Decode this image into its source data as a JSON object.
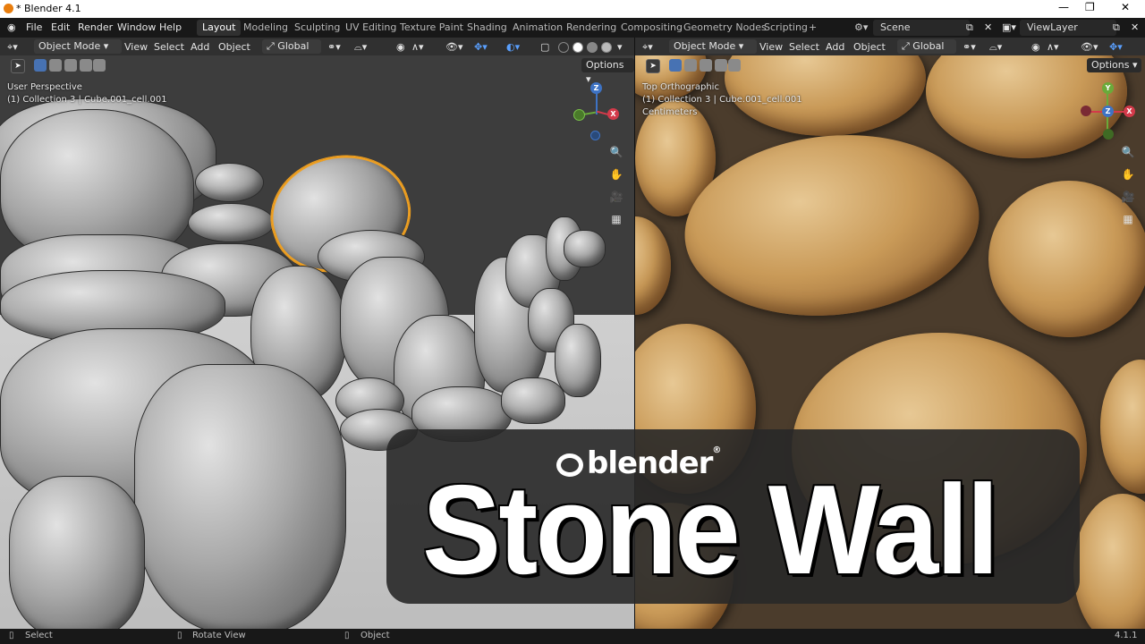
{
  "app": {
    "title": "* Blender 4.1",
    "version": "4.1.1"
  },
  "menu": {
    "items": [
      "File",
      "Edit",
      "Render",
      "Window",
      "Help"
    ],
    "workspaces": [
      "Layout",
      "Modeling",
      "Sculpting",
      "UV Editing",
      "Texture Paint",
      "Shading",
      "Animation",
      "Rendering",
      "Compositing",
      "Geometry Nodes",
      "Scripting"
    ],
    "active_workspace": "Layout",
    "add_tab": "+",
    "scene": "Scene",
    "view_layer": "ViewLayer"
  },
  "left_viewport": {
    "mode": "Object Mode",
    "menus": [
      "View",
      "Select",
      "Add",
      "Object"
    ],
    "orientation": "Global",
    "options": "Options",
    "overlay_line1": "User Perspective",
    "overlay_line2": "(1) Collection 3 | Cube.001_cell.001"
  },
  "right_viewport": {
    "mode": "Object Mode",
    "menus": [
      "View",
      "Select",
      "Add",
      "Object"
    ],
    "orientation": "Global",
    "options": "Options",
    "overlay_line1": "Top Orthographic",
    "overlay_line2": "(1) Collection 3 | Cube.001_cell.001",
    "overlay_line3": "Centimeters"
  },
  "gizmo": {
    "x": "X",
    "y": "Y",
    "z": "Z"
  },
  "banner": {
    "logo_text": "blender",
    "title": "Stone Wall"
  },
  "status": {
    "select": "Select",
    "rotate": "Rotate View",
    "object": "Object",
    "version": "4.1.1"
  },
  "colors": {
    "accent": "#e87d0d",
    "header_bg": "#303030",
    "selection_outline": "#f0a020"
  }
}
